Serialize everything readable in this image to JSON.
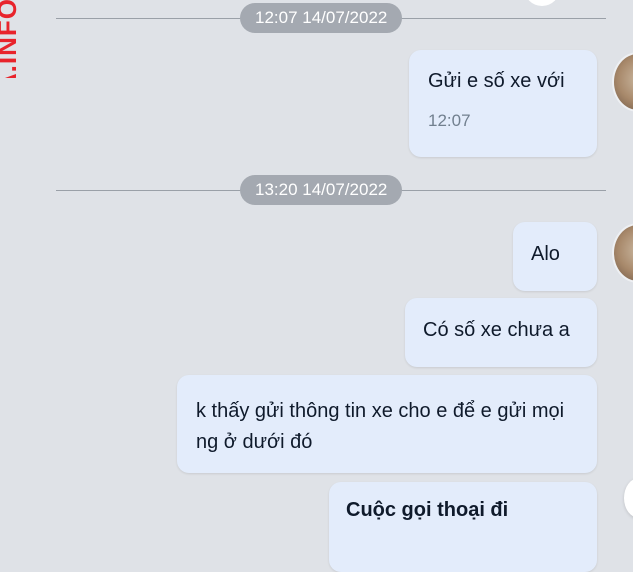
{
  "watermark": "A.INFO",
  "separators": [
    {
      "label": "12:07 14/07/2022"
    },
    {
      "label": "13:20 14/07/2022"
    }
  ],
  "messages": [
    {
      "text": "Gửi e số xe với",
      "time": "12:07"
    },
    {
      "text": "Alo"
    },
    {
      "text": "Có số xe chưa a"
    },
    {
      "text": "k thấy gửi thông tin xe cho e để e gửi mọi ng ở dưới đó"
    },
    {
      "text": "Cuộc gọi thoại đi"
    }
  ]
}
